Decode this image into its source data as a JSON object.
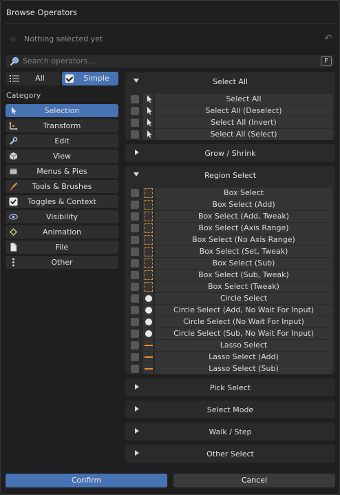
{
  "window": {
    "title": "Browse Operators"
  },
  "background_row": {
    "text": "Nothing selected yet"
  },
  "search": {
    "placeholder": "Search operators...",
    "shortcut": "F"
  },
  "mode": {
    "all_label": "All",
    "simple_label": "Simple",
    "simple_checked": true
  },
  "category": {
    "label": "Category",
    "items": [
      {
        "label": "Selection",
        "icon": "cursor-arrow-icon",
        "active": true
      },
      {
        "label": "Transform",
        "icon": "transform-axes-icon",
        "active": false
      },
      {
        "label": "Edit",
        "icon": "wrench-icon",
        "active": false
      },
      {
        "label": "View",
        "icon": "cube-icon",
        "active": false
      },
      {
        "label": "Menus & Pies",
        "icon": "window-icon",
        "active": false
      },
      {
        "label": "Tools & Brushes",
        "icon": "brush-icon",
        "active": false
      },
      {
        "label": "Toggles & Context",
        "icon": "checkbox-icon",
        "active": false
      },
      {
        "label": "Visibility",
        "icon": "eye-icon",
        "active": false
      },
      {
        "label": "Animation",
        "icon": "keyframe-icon",
        "active": false
      },
      {
        "label": "File",
        "icon": "file-icon",
        "active": false
      },
      {
        "label": "Other",
        "icon": "vertical-dots-icon",
        "active": false
      }
    ]
  },
  "panels": [
    {
      "title": "Select All",
      "expanded": true,
      "ops": [
        {
          "label": "Select All",
          "icon": "cursor-arrow-icon"
        },
        {
          "label": "Select All (Deselect)",
          "icon": "cursor-arrow-icon"
        },
        {
          "label": "Select All (Invert)",
          "icon": "cursor-arrow-icon"
        },
        {
          "label": "Select All (Select)",
          "icon": "cursor-arrow-icon"
        }
      ]
    },
    {
      "title": "Grow / Shrink",
      "expanded": false,
      "ops": []
    },
    {
      "title": "Region Select",
      "expanded": true,
      "ops": [
        {
          "label": "Box Select",
          "icon": "box-select-icon"
        },
        {
          "label": "Box Select (Add)",
          "icon": "box-select-icon"
        },
        {
          "label": "Box Select (Add, Tweak)",
          "icon": "box-select-icon"
        },
        {
          "label": "Box Select (Axis Range)",
          "icon": "box-select-icon"
        },
        {
          "label": "Box Select (No Axis Range)",
          "icon": "box-select-icon"
        },
        {
          "label": "Box Select (Set, Tweak)",
          "icon": "box-select-icon"
        },
        {
          "label": "Box Select (Sub)",
          "icon": "box-select-icon"
        },
        {
          "label": "Box Select (Sub, Tweak)",
          "icon": "box-select-icon"
        },
        {
          "label": "Box Select (Tweak)",
          "icon": "box-select-icon"
        },
        {
          "label": "Circle Select",
          "icon": "circle-select-icon"
        },
        {
          "label": "Circle Select (Add, No Wait For Input)",
          "icon": "circle-select-icon"
        },
        {
          "label": "Circle Select (No Wait For Input)",
          "icon": "circle-select-icon"
        },
        {
          "label": "Circle Select (Sub, No Wait For Input)",
          "icon": "circle-select-icon"
        },
        {
          "label": "Lasso Select",
          "icon": "lasso-select-icon"
        },
        {
          "label": "Lasso Select (Add)",
          "icon": "lasso-select-icon"
        },
        {
          "label": "Lasso Select (Sub)",
          "icon": "lasso-select-icon"
        }
      ]
    },
    {
      "title": "Pick Select",
      "expanded": false,
      "ops": []
    },
    {
      "title": "Select Mode",
      "expanded": false,
      "ops": []
    },
    {
      "title": "Walk / Step",
      "expanded": false,
      "ops": []
    },
    {
      "title": "Other Select",
      "expanded": false,
      "ops": []
    }
  ],
  "footer": {
    "confirm_label": "Confirm",
    "cancel_label": "Cancel"
  },
  "colors": {
    "accent": "#4772b3",
    "panel": "#2a2a2a",
    "box_select_outline": "#d5913a",
    "lasso": "#e8912e"
  }
}
